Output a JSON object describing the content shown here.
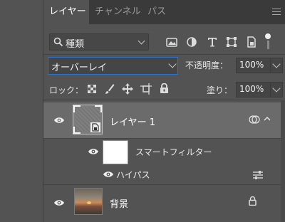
{
  "tabs": [
    {
      "label": "レイヤー",
      "active": true
    },
    {
      "label": "チャンネル",
      "active": false
    },
    {
      "label": "パス",
      "active": false
    }
  ],
  "filter": {
    "kind_label": "種類"
  },
  "blend": {
    "mode": "オーバーレイ",
    "opacity_label": "不透明度：",
    "opacity": "100%"
  },
  "lock": {
    "label": "ロック：",
    "fill_label": "塗り：",
    "fill": "100%"
  },
  "layers": {
    "layer1": {
      "name": "レイヤー 1"
    },
    "smart_filter": {
      "name": "スマートフィルター"
    },
    "high_pass": {
      "name": "ハイパス"
    },
    "background": {
      "name": "背景"
    }
  },
  "colors": {
    "accent": "#2f72c6",
    "selected_row": "#6b6b6b",
    "panel": "#535353"
  }
}
